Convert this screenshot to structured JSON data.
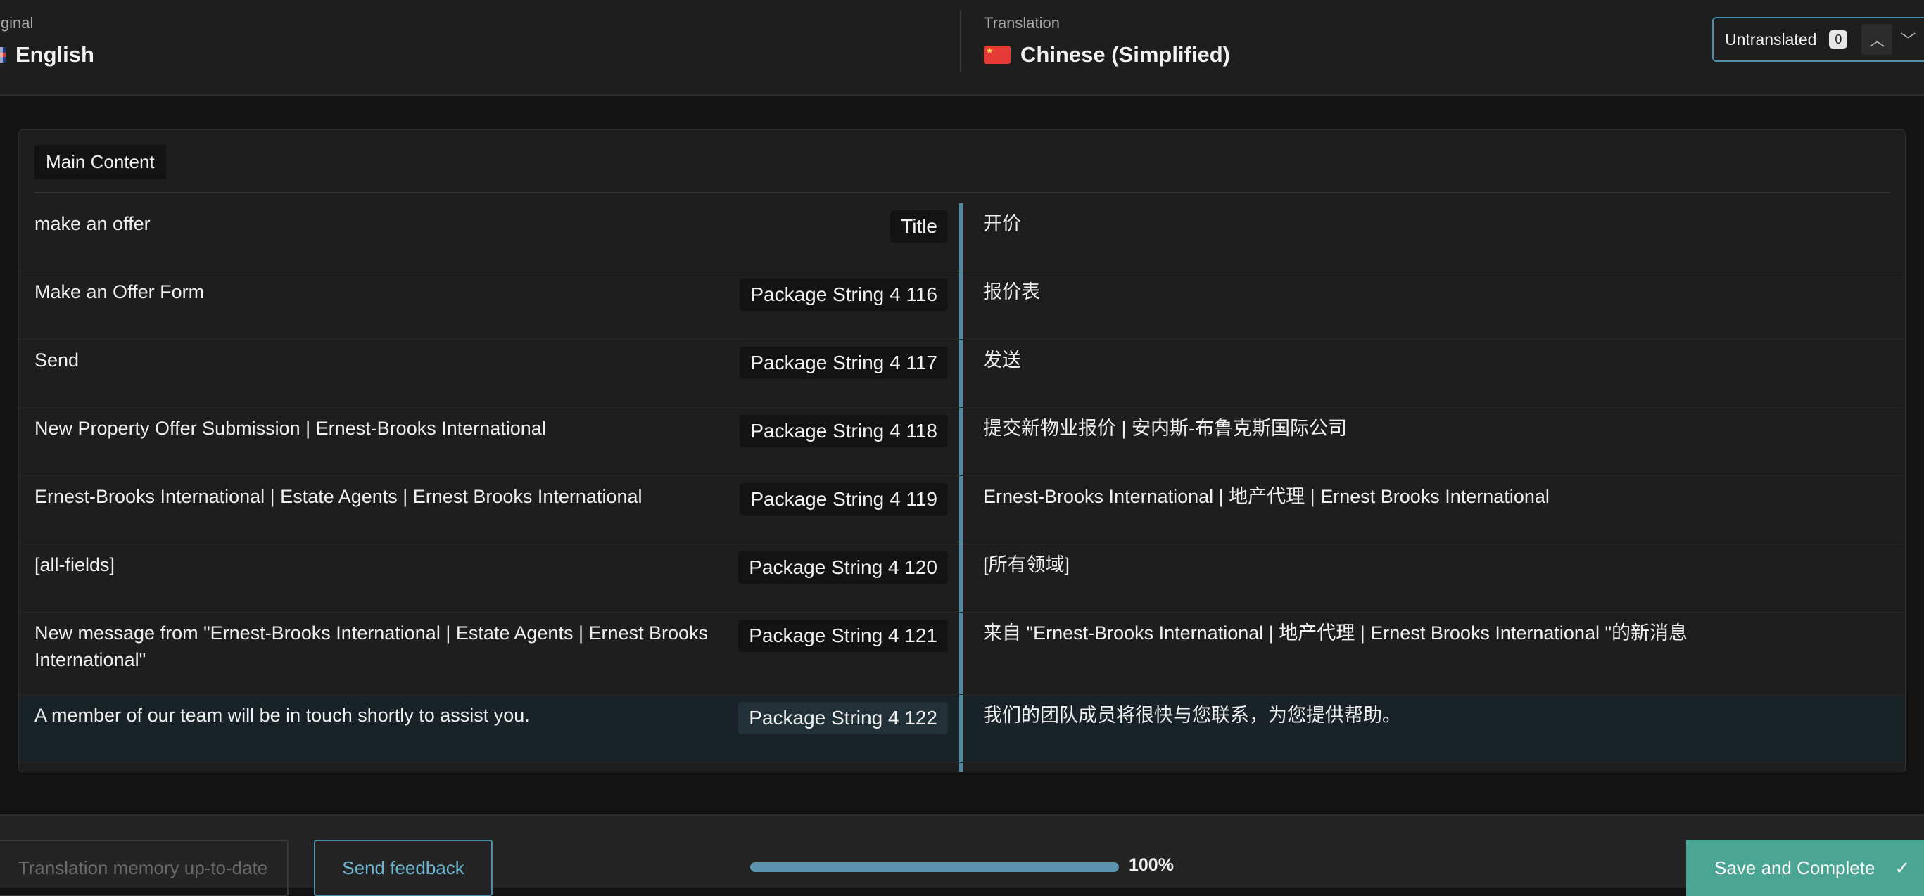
{
  "header": {
    "original_label": "iginal",
    "original_lang": "English",
    "translation_label": "Translation",
    "translation_lang": "Chinese (Simplified)",
    "filter": {
      "label": "Untranslated",
      "count": "0"
    }
  },
  "section": {
    "name": "Main Content"
  },
  "rows": [
    {
      "original": "make an offer",
      "tag": "Title",
      "translation": "开价"
    },
    {
      "original": "Make an Offer Form",
      "tag": "Package String 4 116",
      "translation": "报价表"
    },
    {
      "original": "Send",
      "tag": "Package String 4 117",
      "translation": "发送"
    },
    {
      "original": "New Property Offer Submission | Ernest-Brooks International",
      "tag": "Package String 4 118",
      "translation": "提交新物业报价 | 安内斯-布鲁克斯国际公司"
    },
    {
      "original": "Ernest-Brooks International | Estate Agents | Ernest Brooks International",
      "tag": "Package String 4 119",
      "translation": "Ernest-Brooks International | 地产代理 | Ernest Brooks International"
    },
    {
      "original": "[all-fields]",
      "tag": "Package String 4 120",
      "translation": "[所有领域]"
    },
    {
      "original": "New message from \"Ernest-Brooks International | Estate Agents | Ernest Brooks International\"",
      "tag": "Package String 4 121",
      "translation": "来自 \"Ernest-Brooks International | 地产代理 | Ernest Brooks International \"的新消息"
    },
    {
      "original": "A member of our team will be in touch shortly to assist you.",
      "tag": "Package String 4 122",
      "translation": "我们的团队成员将很快与您联系，为您提供帮助。"
    }
  ],
  "footer": {
    "tm_status": "Translation memory up-to-date",
    "feedback_label": "Send feedback",
    "progress_percent": 100,
    "progress_text": "100%",
    "save_label": "Save and Complete"
  }
}
